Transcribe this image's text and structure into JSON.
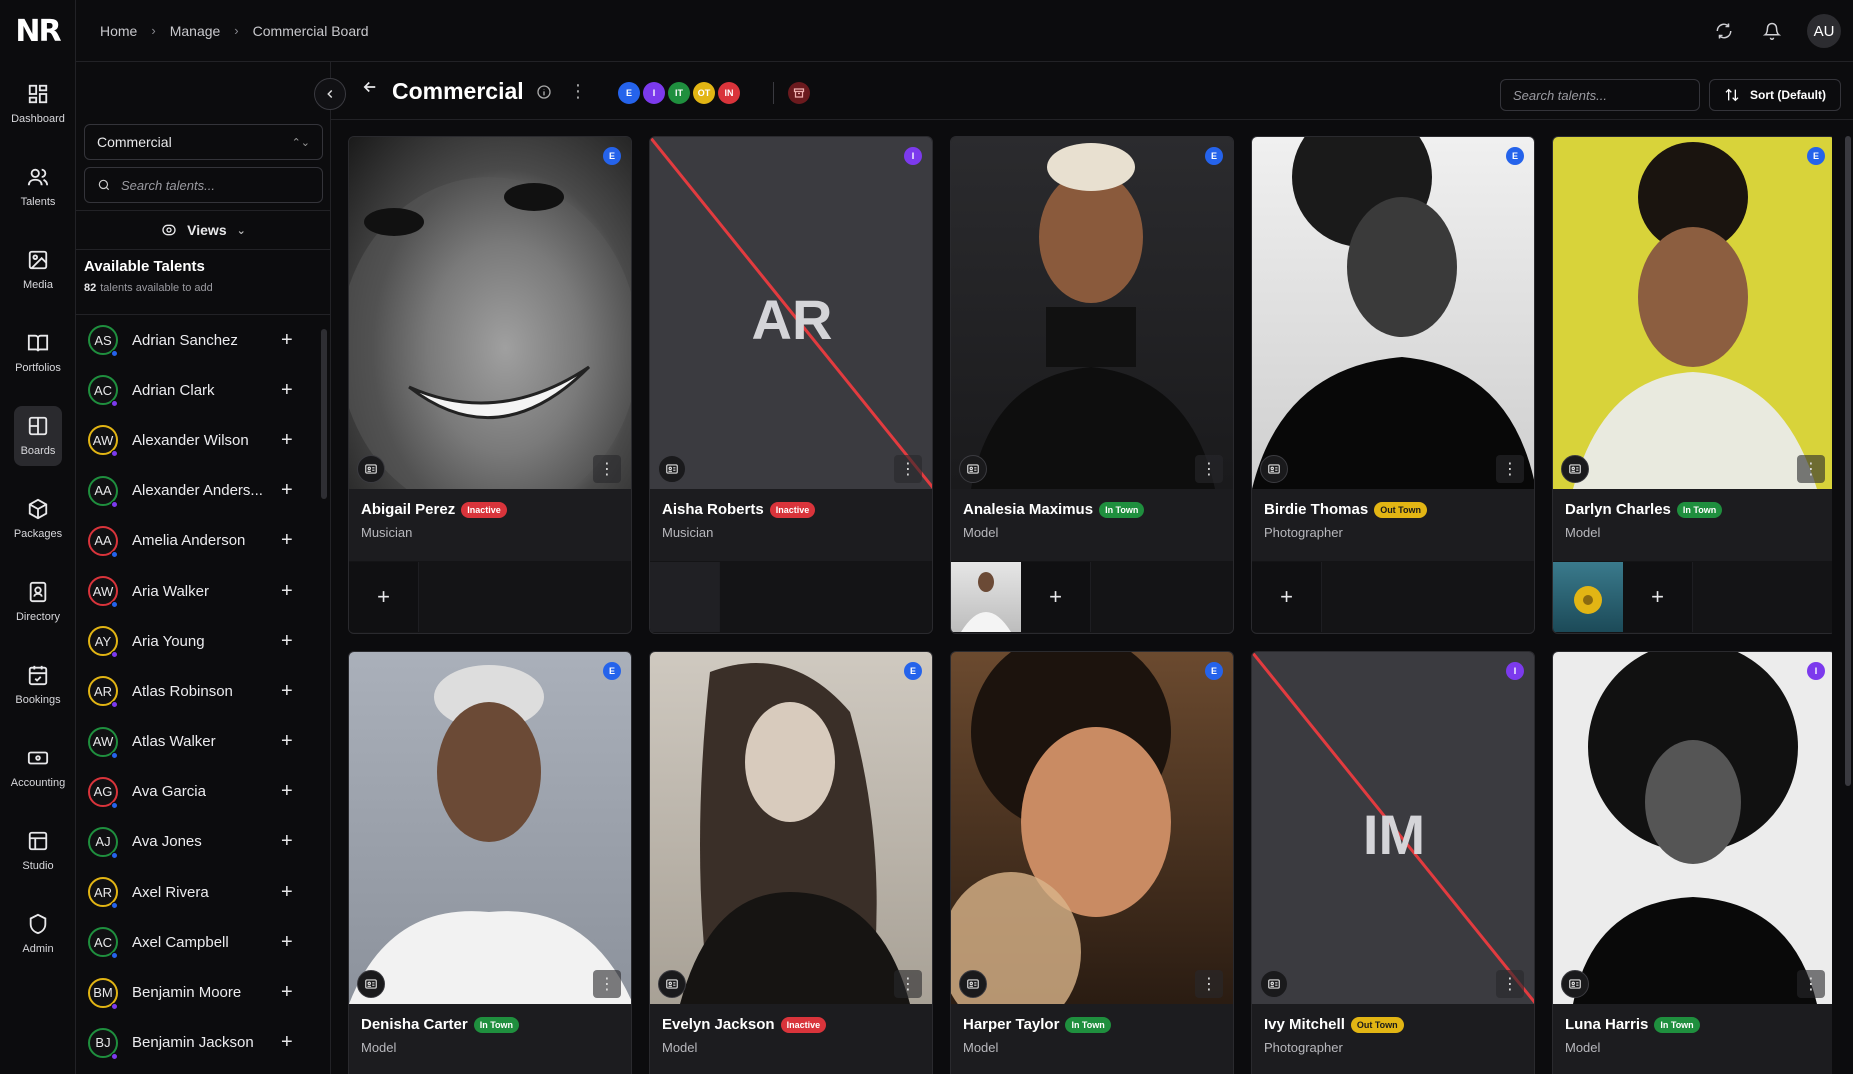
{
  "app": {
    "logo": "NR"
  },
  "nav": [
    {
      "label": "Dashboard",
      "icon": "dashboard-icon"
    },
    {
      "label": "Talents",
      "icon": "users-icon"
    },
    {
      "label": "Media",
      "icon": "image-icon"
    },
    {
      "label": "Portfolios",
      "icon": "book-icon"
    },
    {
      "label": "Boards",
      "icon": "board-icon",
      "active": true
    },
    {
      "label": "Packages",
      "icon": "package-icon"
    },
    {
      "label": "Directory",
      "icon": "directory-icon"
    },
    {
      "label": "Bookings",
      "icon": "calendar-check-icon"
    },
    {
      "label": "Accounting",
      "icon": "cash-icon"
    },
    {
      "label": "Studio",
      "icon": "studio-icon"
    },
    {
      "label": "Admin",
      "icon": "shield-icon"
    }
  ],
  "breadcrumb": [
    "Home",
    "Manage",
    "Commercial Board"
  ],
  "user": {
    "initials": "AU"
  },
  "side": {
    "board_select": "Commercial",
    "search_placeholder": "Search talents...",
    "views_label": "Views",
    "available_title": "Available Talents",
    "available_count": "82",
    "available_suffix": "talents available to add",
    "talents": [
      {
        "initials": "AS",
        "name": "Adrian Sanchez",
        "ring": "#1f8f3e",
        "dot": "#2563eb"
      },
      {
        "initials": "AC",
        "name": "Adrian Clark",
        "ring": "#1f8f3e",
        "dot": "#7c3aed"
      },
      {
        "initials": "AW",
        "name": "Alexander Wilson",
        "ring": "#e2b514",
        "dot": "#7c3aed"
      },
      {
        "initials": "AA",
        "name": "Alexander Anders...",
        "ring": "#1f8f3e",
        "dot": "#7c3aed"
      },
      {
        "initials": "AA",
        "name": "Amelia Anderson",
        "ring": "#d9343b",
        "dot": "#2563eb"
      },
      {
        "initials": "AW",
        "name": "Aria Walker",
        "ring": "#d9343b",
        "dot": "#2563eb"
      },
      {
        "initials": "AY",
        "name": "Aria Young",
        "ring": "#e2b514",
        "dot": "#7c3aed"
      },
      {
        "initials": "AR",
        "name": "Atlas Robinson",
        "ring": "#e2b514",
        "dot": "#7c3aed"
      },
      {
        "initials": "AW",
        "name": "Atlas Walker",
        "ring": "#1f8f3e",
        "dot": "#2563eb"
      },
      {
        "initials": "AG",
        "name": "Ava Garcia",
        "ring": "#d9343b",
        "dot": "#2563eb"
      },
      {
        "initials": "AJ",
        "name": "Ava Jones",
        "ring": "#1f8f3e",
        "dot": "#2563eb"
      },
      {
        "initials": "AR",
        "name": "Axel Rivera",
        "ring": "#e2b514",
        "dot": "#2563eb"
      },
      {
        "initials": "AC",
        "name": "Axel Campbell",
        "ring": "#1f8f3e",
        "dot": "#2563eb"
      },
      {
        "initials": "BM",
        "name": "Benjamin Moore",
        "ring": "#e2b514",
        "dot": "#7c3aed"
      },
      {
        "initials": "BJ",
        "name": "Benjamin Jackson",
        "ring": "#1f8f3e",
        "dot": "#7c3aed"
      }
    ]
  },
  "header": {
    "title": "Commercial",
    "filters": [
      {
        "label": "E",
        "color": "#2563eb"
      },
      {
        "label": "I",
        "color": "#7c3aed"
      },
      {
        "label": "IT",
        "color": "#1f8f3e"
      },
      {
        "label": "OT",
        "color": "#e2b514"
      },
      {
        "label": "IN",
        "color": "#d9343b"
      }
    ],
    "search_placeholder": "Search talents...",
    "sort_label": "Sort (Default)"
  },
  "cards": [
    {
      "name": "Abigail Perez",
      "status": "Inactive",
      "status_type": "inactive",
      "role": "Musician",
      "badge": "E",
      "badge_color": "#2563eb",
      "photo": "bw-smile",
      "footer": "add"
    },
    {
      "name": "Aisha Roberts",
      "status": "Inactive",
      "status_type": "inactive",
      "role": "Musician",
      "badge": "I",
      "badge_color": "#7c3aed",
      "photo": "placeholder",
      "initials": "AR",
      "footer": "empty"
    },
    {
      "name": "Analesia Maximus",
      "status": "In Town",
      "status_type": "intown",
      "role": "Model",
      "badge": "E",
      "badge_color": "#2563eb",
      "photo": "dark-turtleneck",
      "footer": "thumb-add"
    },
    {
      "name": "Birdie Thomas",
      "status": "Out Town",
      "status_type": "outtown",
      "role": "Photographer",
      "badge": "E",
      "badge_color": "#2563eb",
      "photo": "bw-curls",
      "footer": "add"
    },
    {
      "name": "Darlyn Charles",
      "status": "In Town",
      "status_type": "intown",
      "role": "Model",
      "badge": "E",
      "badge_color": "#2563eb",
      "photo": "yellow-bg",
      "footer": "thumb-add"
    },
    {
      "name": "Denisha Carter",
      "status": "In Town",
      "status_type": "intown",
      "role": "Model",
      "badge": "E",
      "badge_color": "#2563eb",
      "photo": "grey-bg",
      "footer": "none"
    },
    {
      "name": "Evelyn Jackson",
      "status": "Inactive",
      "status_type": "inactive",
      "role": "Model",
      "badge": "E",
      "badge_color": "#2563eb",
      "photo": "sepia",
      "footer": "none"
    },
    {
      "name": "Harper Taylor",
      "status": "In Town",
      "status_type": "intown",
      "role": "Model",
      "badge": "E",
      "badge_color": "#2563eb",
      "photo": "warm",
      "footer": "none"
    },
    {
      "name": "Ivy Mitchell",
      "status": "Out Town",
      "status_type": "outtown",
      "role": "Photographer",
      "badge": "I",
      "badge_color": "#7c3aed",
      "photo": "placeholder",
      "initials": "IM",
      "footer": "none"
    },
    {
      "name": "Luna Harris",
      "status": "In Town",
      "status_type": "intown",
      "role": "Model",
      "badge": "I",
      "badge_color": "#7c3aed",
      "photo": "bw-afro",
      "footer": "none"
    }
  ]
}
